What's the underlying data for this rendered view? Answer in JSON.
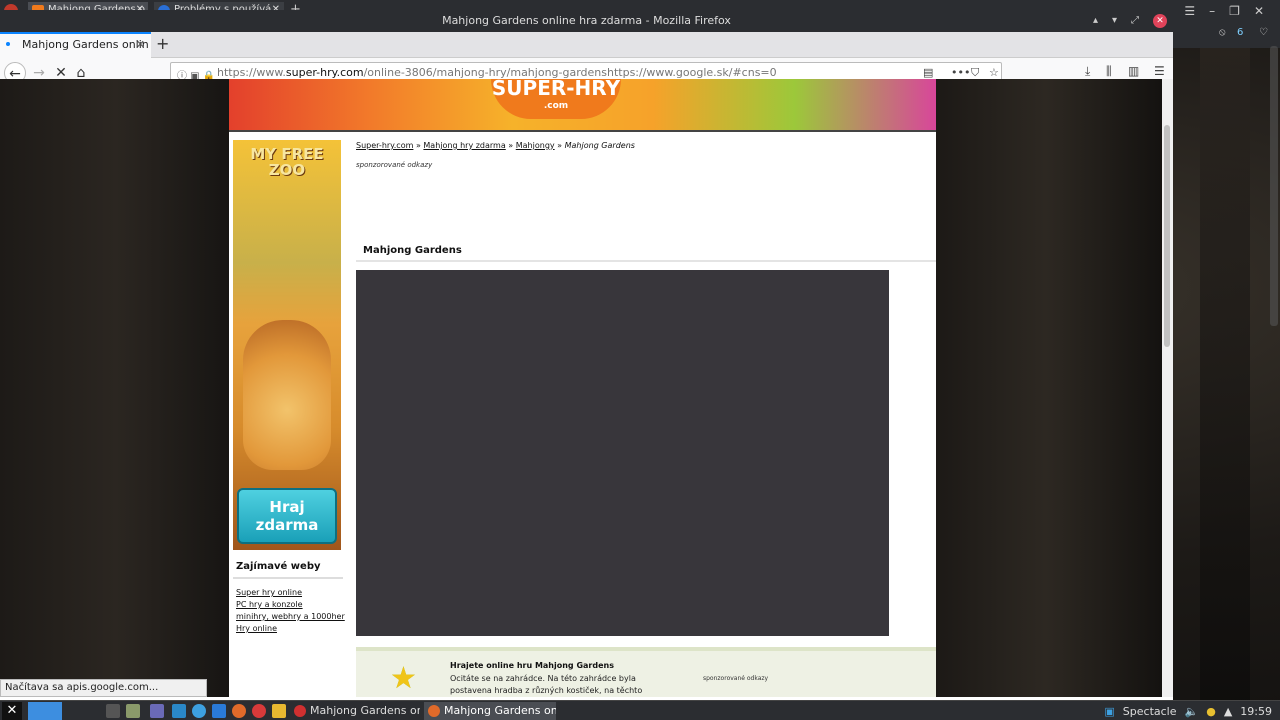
{
  "system_panel": {
    "tabs": [
      {
        "label": "Mahjong Gardens o"
      },
      {
        "label": "Problémy s používá"
      }
    ],
    "tray_badge": "6"
  },
  "window": {
    "title": "Mahjong Gardens online hra zdarma - Mozilla Firefox"
  },
  "browser": {
    "tab": {
      "label": "Mahjong Gardens onlin"
    },
    "url_domain": "https://www.",
    "url_host": "super-hry.com",
    "url_path": "/online-3806/mahjong-hry/mahjong-gardenshttps://www.google.sk/#cns=0",
    "status": "Načítava sa apis.google.com..."
  },
  "page": {
    "banner_logo": "SUPER-HRY",
    "banner_logo_sub": ".com",
    "ad": {
      "title": "MY FREE ZOO",
      "button": "Hraj zdarma"
    },
    "sidebar": {
      "heading": "Zajímavé weby",
      "links": [
        "Super hry online",
        "PC hry a konzole",
        "minihry, webhry a 1000her",
        "Hry online"
      ]
    },
    "breadcrumb": {
      "items": [
        "Super-hry.com",
        "Mahjong hry zdarma",
        "Mahjongy"
      ],
      "sep": "»",
      "current": "Mahjong Gardens"
    },
    "sponsored_label": "sponzorované odkazy",
    "game_title": "Mahjong Gardens",
    "info": {
      "title": "Hrajete online hru Mahjong Gardens",
      "text": "Ocitáte se na zahrádce. Na této zahrádce byla postavena hradba z různých kostiček, na těchto kostičkách jsou obrázky,",
      "sponsored": "sponzorované odkazy"
    }
  },
  "taskbar": {
    "windows": [
      {
        "label": "Mahjong Gardens onli..."
      },
      {
        "label": "Mahjong Gardens onlin..."
      }
    ],
    "tray_app": "Spectacle",
    "clock": "19:59"
  },
  "colors": {
    "accent": "#0a84ff",
    "game_bg": "#38363b",
    "info_bg": "#eef1e4"
  }
}
